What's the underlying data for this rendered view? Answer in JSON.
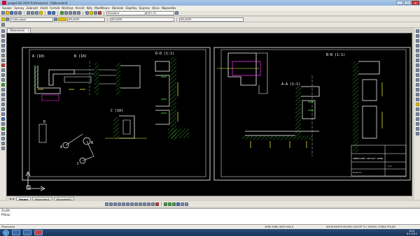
{
  "window": {
    "title": "progeCAD 2010 Professional - [Obkreslení]",
    "min": "_",
    "max": "□",
    "close": "✕"
  },
  "menu": [
    "Soubor",
    "Úpravy",
    "Zobrazit",
    "Vložit",
    "Formát",
    "Nástroje",
    "Kreslit",
    "Kóty",
    "Modifikace",
    "Obrázek",
    "Doplňky",
    "Express",
    "Okno",
    "Nápověda"
  ],
  "toolbar": {
    "layer": "0 kóty popis",
    "color": "BYLAYER",
    "linetype": "BYLAYER",
    "lineweight": "BYLAYER",
    "text_style": "Standard",
    "dim_style": "ISO-25"
  },
  "doc_tab": {
    "label": "Obkreslení",
    "close": "×"
  },
  "layout_tabs": [
    "Model",
    "Rozvržení1",
    "Rozvržení2"
  ],
  "layout_nav": [
    "◄",
    "►"
  ],
  "command": {
    "lines": [
      "Zrušit:",
      "Příkaz:"
    ]
  },
  "status": {
    "left": "Připraveno",
    "coords": "3060.3060,3030.044,0",
    "modes": "KROK  RASTR  KOLMO  UCHOP  TLC  MODEL  STRAS  POLAR"
  },
  "clock": {
    "time": "8:20",
    "date": "8.5.2012"
  },
  "drawing": {
    "labels": {
      "section_a": "A (10)",
      "section_b": "B (10)",
      "section_c": "C (10)",
      "section_dd": "D-D (1:1)",
      "section_aa": "A-A (1:1)",
      "section_bb": "B-B (1:1)",
      "mark_d": "D",
      "mark_a": "A",
      "mark_b": "B",
      "mark_c": "C",
      "tb_title": "OBKRESLENÍ SESTAVY ZÁMKU",
      "tb_num": "1:1",
      "tb_drawn": "Kreslil"
    },
    "colors": {
      "outline": "#ffffff",
      "green": "#4cff4c",
      "yellow": "#ffff33",
      "magenta": "#ff33ff",
      "cyan": "#00ffff"
    }
  }
}
